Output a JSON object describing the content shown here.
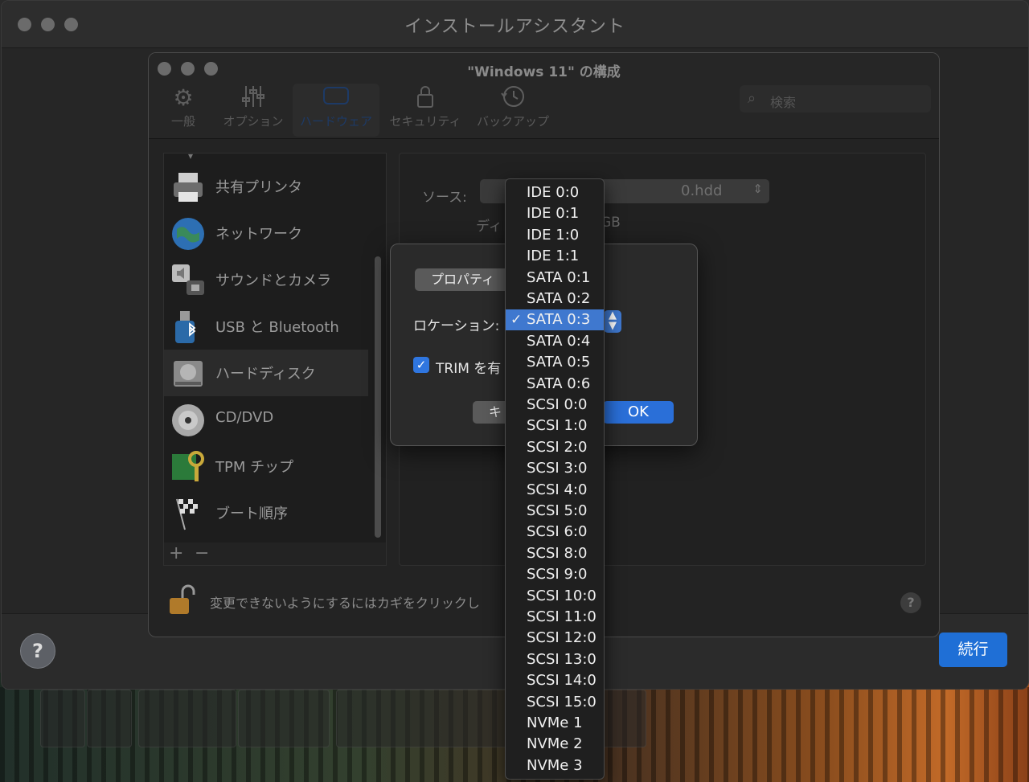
{
  "outer": {
    "title": "インストールアシスタント",
    "continue_label": "続行",
    "help_label": "?"
  },
  "config": {
    "title": "\"Windows 11\" の構成",
    "toolbar": [
      {
        "label": "一般",
        "icon": "gear-icon"
      },
      {
        "label": "オプション",
        "icon": "sliders-icon"
      },
      {
        "label": "ハードウェア",
        "icon": "hardware-icon"
      },
      {
        "label": "セキュリティ",
        "icon": "lock-icon"
      },
      {
        "label": "バックアップ",
        "icon": "clock-icon"
      }
    ],
    "search_placeholder": "検索",
    "sidebar": [
      {
        "label": "共有プリンタ",
        "icon": "printer-icon"
      },
      {
        "label": "ネットワーク",
        "icon": "globe-icon"
      },
      {
        "label": "サウンドとカメラ",
        "icon": "speaker-camera-icon"
      },
      {
        "label": "USB と Bluetooth",
        "icon": "usb-icon"
      },
      {
        "label": "ハードディスク",
        "icon": "hard-disk-icon"
      },
      {
        "label": "CD/DVD",
        "icon": "disc-icon"
      },
      {
        "label": "TPM チップ",
        "icon": "tpm-chip-icon"
      },
      {
        "label": "ブート順序",
        "icon": "checkered-flag-icon"
      }
    ],
    "sidebar_add": "+",
    "sidebar_remove": "−",
    "source_label": "ソース:",
    "source_value": "0.hdd",
    "disk_label": "ディ",
    "disk_size": "GB",
    "lock_text": "変更できないようにするにはカギをクリックし",
    "small_help": "?"
  },
  "sheet": {
    "properties_label": "プロパティ",
    "location_label": "ロケーション:",
    "trim_label": "TRIM を有",
    "cancel_label": "キ",
    "ok_label": "OK"
  },
  "menu": {
    "selected": "SATA 0:3",
    "check": "✓",
    "items": [
      "IDE 0:0",
      "IDE 0:1",
      "IDE 1:0",
      "IDE 1:1",
      "SATA 0:1",
      "SATA 0:2",
      "SATA 0:3",
      "SATA 0:4",
      "SATA 0:5",
      "SATA 0:6",
      "SCSI 0:0",
      "SCSI 1:0",
      "SCSI 2:0",
      "SCSI 3:0",
      "SCSI 4:0",
      "SCSI 5:0",
      "SCSI 6:0",
      "SCSI 8:0",
      "SCSI 9:0",
      "SCSI 10:0",
      "SCSI 11:0",
      "SCSI 12:0",
      "SCSI 13:0",
      "SCSI 14:0",
      "SCSI 15:0",
      "NVMe 1",
      "NVMe 2",
      "NVMe 3"
    ]
  }
}
